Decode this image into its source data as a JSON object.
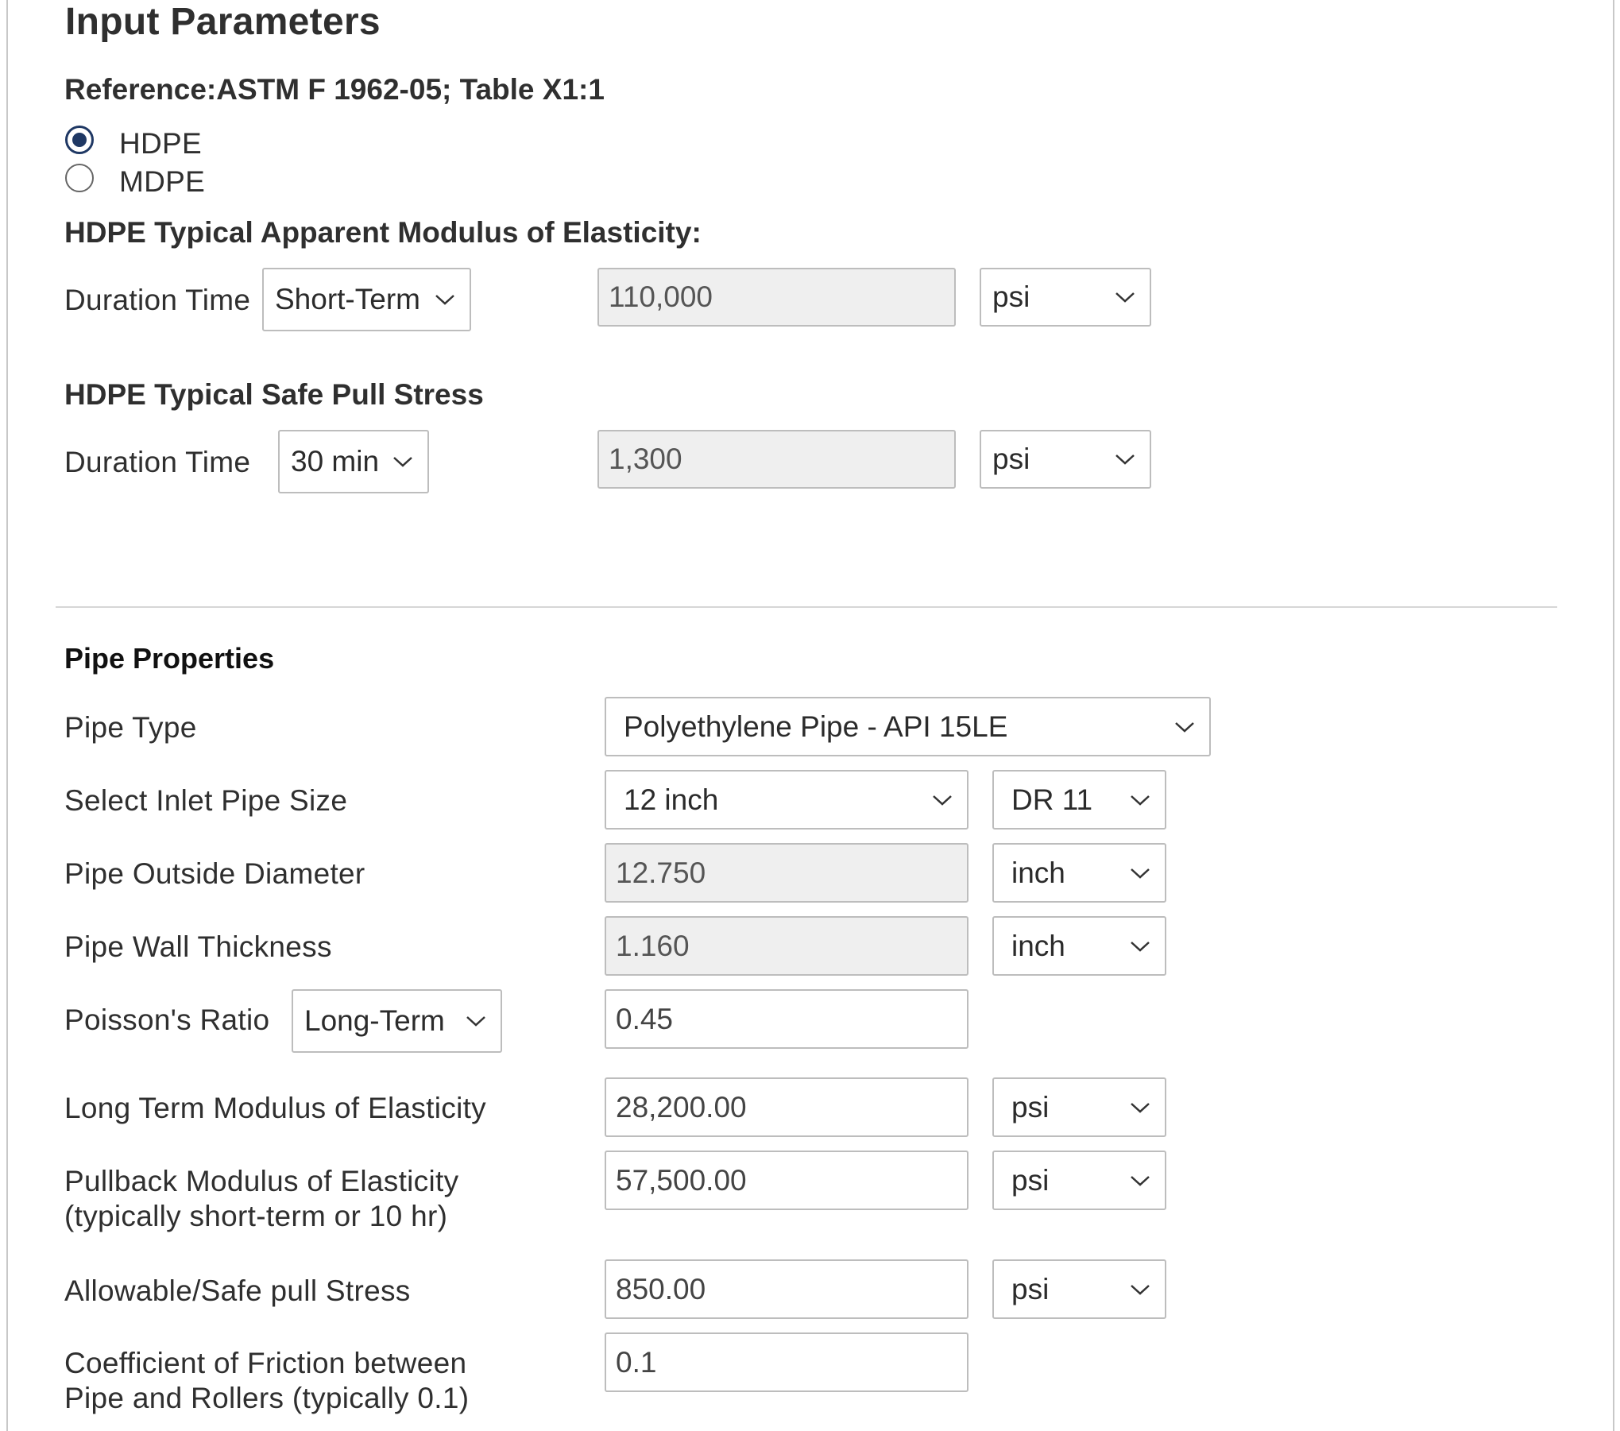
{
  "page": {
    "title": "Input Parameters",
    "reference": "Reference:ASTM F 1962-05; Table X1:1"
  },
  "material": {
    "options": [
      {
        "label": "HDPE",
        "selected": true
      },
      {
        "label": "MDPE",
        "selected": false
      }
    ]
  },
  "modulus": {
    "heading": "HDPE Typical Apparent Modulus of Elasticity:",
    "duration_label": "Duration Time",
    "duration_value": "Short-Term",
    "value": "110,000",
    "unit": "psi"
  },
  "pull_stress": {
    "heading": "HDPE Typical Safe Pull Stress",
    "duration_label": "Duration Time",
    "duration_value": "30 min",
    "value": "1,300",
    "unit": "psi"
  },
  "pipe": {
    "heading": "Pipe Properties",
    "type_label": "Pipe Type",
    "type_value": "Polyethylene Pipe - API 15LE",
    "size_label": "Select Inlet Pipe Size",
    "size_value": "12 inch",
    "dr_value": "DR 11",
    "od_label": "Pipe Outside Diameter",
    "od_value": "12.750",
    "od_unit": "inch",
    "wall_label": "Pipe Wall Thickness",
    "wall_value": "1.160",
    "wall_unit": "inch",
    "poisson_label": "Poisson's Ratio",
    "poisson_term": "Long-Term",
    "poisson_value": "0.45",
    "ltm_label": "Long Term Modulus of Elasticity",
    "ltm_value": "28,200.00",
    "ltm_unit": "psi",
    "pbm_label_1": "Pullback Modulus of Elasticity",
    "pbm_label_2": "(typically short-term or 10 hr)",
    "pbm_value": "57,500.00",
    "pbm_unit": "psi",
    "allow_label": "Allowable/Safe pull Stress",
    "allow_value": "850.00",
    "allow_unit": "psi",
    "cof_label_1": "Coefficient of Friction between",
    "cof_label_2": "Pipe and Rollers (typically 0.1)",
    "cof_value": "0.1"
  },
  "colors": {
    "radio_selected": "#1f3864",
    "readonly_bg": "#efefef",
    "border": "#bdbdbd"
  }
}
